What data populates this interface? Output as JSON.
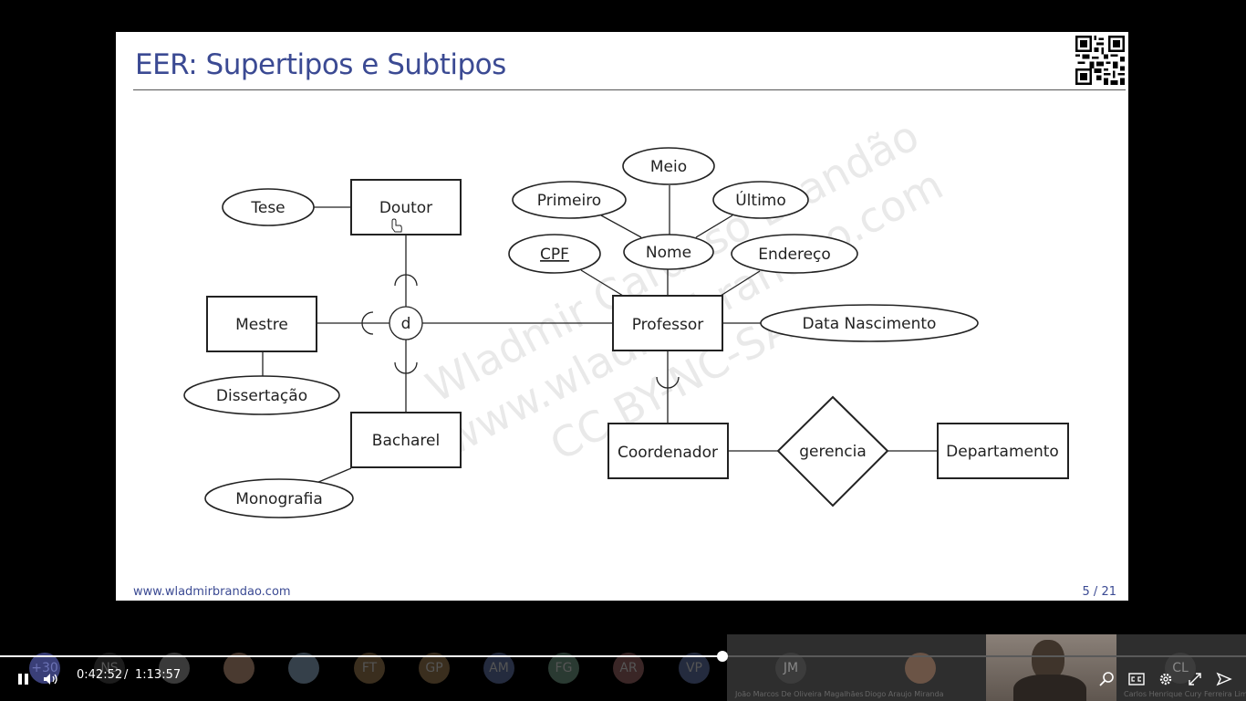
{
  "slide": {
    "title": "EER: Supertipos e Subtipos",
    "footer_url": "www.wladmirbrandao.com",
    "page_number": "5 / 21",
    "watermark_lines": [
      "Wladmir Cardoso Brandão",
      "www.wladmirbrandao.com",
      "CC BY-NC-SA"
    ]
  },
  "diagram": {
    "entities": [
      "Doutor",
      "Mestre",
      "Bacharel",
      "Professor",
      "Coordenador",
      "Departamento"
    ],
    "attributes": [
      "Tese",
      "Dissertação",
      "Monografia",
      "Meio",
      "Primeiro",
      "Último",
      "Nome",
      "CPF",
      "Endereço",
      "Data Nascimento"
    ],
    "key_attribute": "CPF",
    "specialization_symbol": "d",
    "relationship": "gerencia"
  },
  "player": {
    "current_time": "0:42:52",
    "separator": "/",
    "duration": "1:13:57",
    "progress_fraction": 0.5797,
    "icons": [
      "pause-icon",
      "volume-icon",
      "search-icon",
      "captions-icon",
      "settings-icon",
      "fullscreen-icon",
      "share-icon"
    ]
  },
  "participants": [
    {
      "initials": "+30"
    },
    {
      "initials": "NS"
    },
    {
      "initials": ""
    },
    {
      "initials": ""
    },
    {
      "initials": ""
    },
    {
      "initials": "FT"
    },
    {
      "initials": "GP"
    },
    {
      "initials": "AM"
    },
    {
      "initials": "FG"
    },
    {
      "initials": "AR"
    },
    {
      "initials": "VP"
    },
    {
      "initials": "JM",
      "name": "João Marcos De Oliveira Magalhães"
    },
    {
      "initials": "",
      "name": "Diogo Araujo Miranda"
    },
    {
      "initials": "CL",
      "name": "Carlos Henrique Cury Ferreira Lima"
    }
  ]
}
